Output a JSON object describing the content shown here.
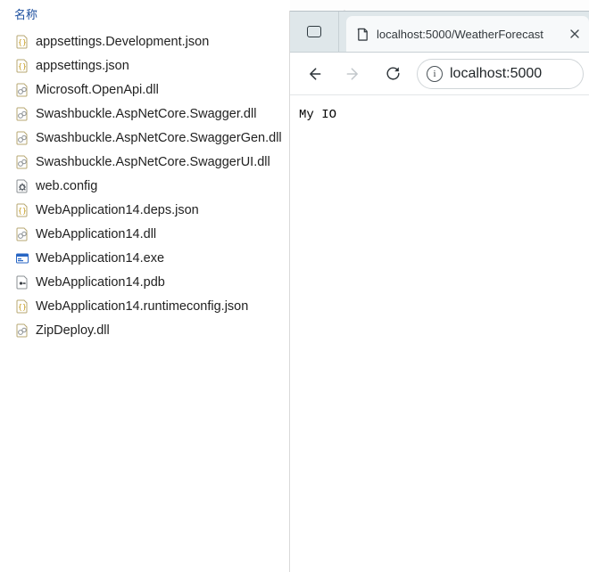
{
  "explorer": {
    "column_header": "名称",
    "files": [
      {
        "name": "appsettings.Development.json",
        "icon": "json"
      },
      {
        "name": "appsettings.json",
        "icon": "json"
      },
      {
        "name": "Microsoft.OpenApi.dll",
        "icon": "dll"
      },
      {
        "name": "Swashbuckle.AspNetCore.Swagger.dll",
        "icon": "dll"
      },
      {
        "name": "Swashbuckle.AspNetCore.SwaggerGen.dll",
        "icon": "dll"
      },
      {
        "name": "Swashbuckle.AspNetCore.SwaggerUI.dll",
        "icon": "dll"
      },
      {
        "name": "web.config",
        "icon": "cfg"
      },
      {
        "name": "WebApplication14.deps.json",
        "icon": "json"
      },
      {
        "name": "WebApplication14.dll",
        "icon": "dll"
      },
      {
        "name": "WebApplication14.exe",
        "icon": "exe"
      },
      {
        "name": "WebApplication14.pdb",
        "icon": "pdb"
      },
      {
        "name": "WebApplication14.runtimeconfig.json",
        "icon": "json"
      },
      {
        "name": "ZipDeploy.dll",
        "icon": "dll"
      }
    ]
  },
  "browser": {
    "tab_title": "localhost:5000/WeatherForecast",
    "address": "localhost:5000",
    "page_body": "My IO"
  }
}
